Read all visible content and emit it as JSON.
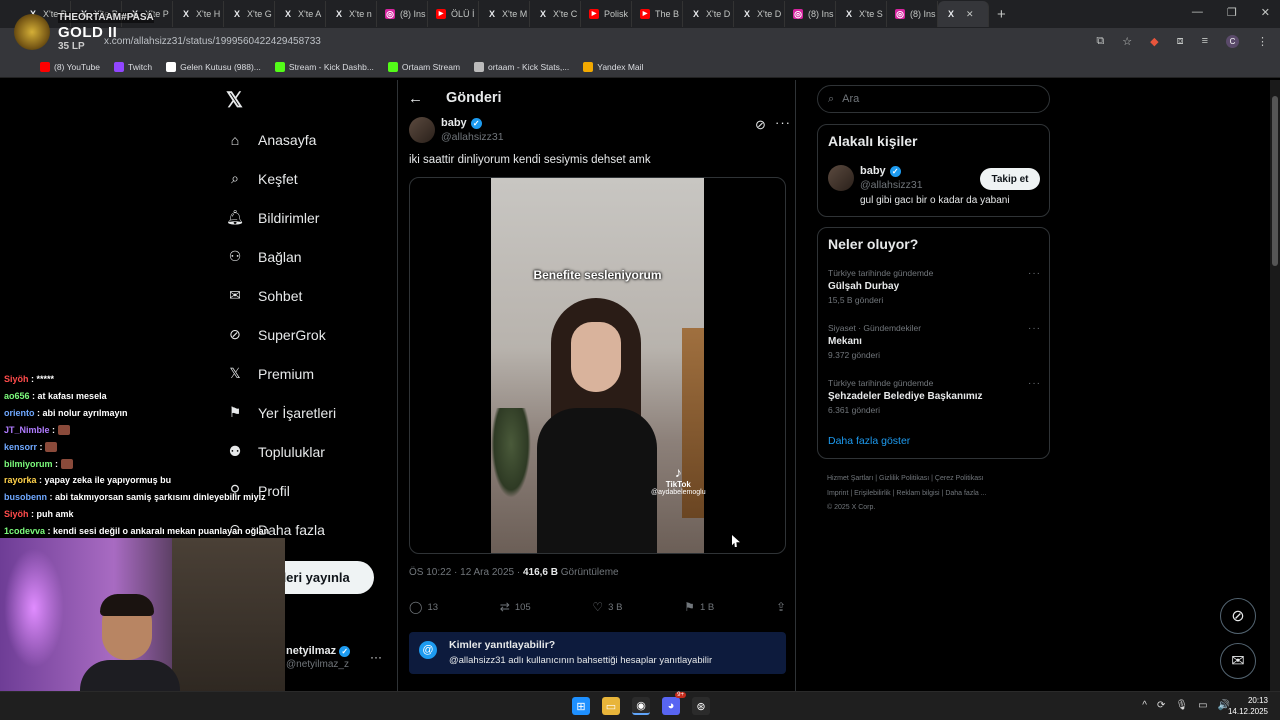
{
  "browser": {
    "tabs": [
      {
        "label": "X'te B",
        "icon": "x"
      },
      {
        "label": "X'te P",
        "icon": "x"
      },
      {
        "label": "X'te P",
        "icon": "x"
      },
      {
        "label": "X'te H",
        "icon": "x"
      },
      {
        "label": "X'te G",
        "icon": "x"
      },
      {
        "label": "X'te A",
        "icon": "x"
      },
      {
        "label": "X'te n",
        "icon": "x"
      },
      {
        "label": "(8) Ins",
        "icon": "instagram"
      },
      {
        "label": "ÖLÜ İ",
        "icon": "youtube"
      },
      {
        "label": "X'te M",
        "icon": "x"
      },
      {
        "label": "X'te C",
        "icon": "x"
      },
      {
        "label": "Polisk",
        "icon": "youtube"
      },
      {
        "label": "The B",
        "icon": "youtube"
      },
      {
        "label": "X'te D",
        "icon": "x"
      },
      {
        "label": "X'te D",
        "icon": "x"
      },
      {
        "label": "(8) Ins",
        "icon": "instagram"
      },
      {
        "label": "X'te S",
        "icon": "x"
      },
      {
        "label": "(8) Ins",
        "icon": "instagram"
      },
      {
        "label": "",
        "icon": "x",
        "active": true
      }
    ],
    "url": "x.com/allahsizz31/status/1999560422429458733",
    "bookmarks": [
      {
        "label": "(8) YouTube",
        "color": "#ff0000"
      },
      {
        "label": "Twitch",
        "color": "#9146ff"
      },
      {
        "label": "Gelen Kutusu (988)...",
        "color": "#ffffff"
      },
      {
        "label": "Stream - Kick Dashb...",
        "color": "#53fc18"
      },
      {
        "label": "Ortaam Stream",
        "color": "#53fc18"
      },
      {
        "label": "ortaam - Kick Stats,...",
        "color": "#bbbbbb"
      },
      {
        "label": "Yandex Mail",
        "color": "#f2a900"
      }
    ]
  },
  "overlay_rank": {
    "name": "THEORTAAM#PASA",
    "tier": "GOLD II",
    "lp": "35 LP"
  },
  "sidebar": {
    "items": [
      {
        "label": "Anasayfa",
        "icon": "home-icon"
      },
      {
        "label": "Keşfet",
        "icon": "search-icon"
      },
      {
        "label": "Bildirimler",
        "icon": "bell-icon"
      },
      {
        "label": "Bağlan",
        "icon": "add-person-icon"
      },
      {
        "label": "Sohbet",
        "icon": "mail-icon"
      },
      {
        "label": "SuperGrok",
        "icon": "grok-icon"
      },
      {
        "label": "Premium",
        "icon": "x-icon"
      },
      {
        "label": "Yer İşaretleri",
        "icon": "bookmark-icon"
      },
      {
        "label": "Topluluklar",
        "icon": "people-icon"
      },
      {
        "label": "Profil",
        "icon": "person-icon"
      },
      {
        "label": "Daha fazla",
        "icon": "more-circle-icon"
      }
    ],
    "post_button": "Gönderi yayınla",
    "user_name": "netyilmaz",
    "user_handle": "@netyilmaz_z"
  },
  "post": {
    "header_title": "Gönderi",
    "author_name": "baby",
    "author_handle": "@allahsizz31",
    "text": "iki saattir dinliyorum kendi sesiymis dehset amk",
    "video_caption": "Benefite sesleniyorum",
    "tiktok_label": "TikTok",
    "tiktok_user": "@aydabelemoglu",
    "timestamp": "ÖS 10:22 · 12 Ara 2025 · ",
    "views_count": "416,6 B",
    "views_label": " Görüntüleme",
    "replies": "13",
    "reposts": "105",
    "likes": "3 B",
    "bookmarks": "1 B",
    "reply_box_title": "Kimler yanıtlayabilir?",
    "reply_box_text": "@allahsizz31 adlı kullanıcının bahsettiği hesaplar yanıtlayabilir"
  },
  "right": {
    "search_placeholder": "Ara",
    "related_title": "Alakalı kişiler",
    "related_name": "baby",
    "related_handle": "@allahsizz31",
    "related_bio": "gul gibi gacı bir o kadar da yabani",
    "follow_label": "Takip et",
    "trends_title": "Neler oluyor?",
    "trends": [
      {
        "context": "Türkiye tarihinde gündemde",
        "name": "Gülşah Durbay",
        "posts": "15,5 B gönderi"
      },
      {
        "context": "Siyaset · Gündemdekiler",
        "name": "Mekanı",
        "posts": "9.372 gönderi"
      },
      {
        "context": "Türkiye tarihinde gündemde",
        "name": "Şehzadeler Belediye Başkanımız",
        "posts": "6.361 gönderi"
      }
    ],
    "show_more": "Daha fazla göster",
    "footer_links": [
      "Hizmet Şartları",
      "Gizlilik Politikası",
      "Çerez Politikası",
      "Imprint",
      "Erişilebilirlik",
      "Reklam bilgisi",
      "Daha fazla ..."
    ],
    "copyright": "© 2025 X Corp."
  },
  "chat": [
    {
      "user": "Siyöh",
      "color": "#ff4b4b",
      "msg": " : *****"
    },
    {
      "user": "ao656",
      "color": "#7cfc7c",
      "msg": " : at kafası mesela"
    },
    {
      "user": "oriento",
      "color": "#6fa8ff",
      "msg": " : abi nolur ayrılmayın"
    },
    {
      "user": "JT_Nimble",
      "color": "#b07cff",
      "msg": " : "
    },
    {
      "user": "kensorr",
      "color": "#6fa8ff",
      "msg": " : "
    },
    {
      "user": "bilmiyorum",
      "color": "#7cfc7c",
      "msg": " : "
    },
    {
      "user": "rayorka",
      "color": "#ffd24b",
      "msg": " : yapay zeka ile yapıyormuş bu"
    },
    {
      "user": "busobenn",
      "color": "#6fa8ff",
      "msg": " : abi takmıyorsan samiş şarkısını dinleyebilir miyiz"
    },
    {
      "user": "Siyöh",
      "color": "#ff4b4b",
      "msg": " : puh amk"
    },
    {
      "user": "1codevva",
      "color": "#7cfc7c",
      "msg": " : kendi sesi değil o ankaralı mekan puanlayan oğlan"
    }
  ],
  "taskbar": {
    "time": "20:13",
    "date": "14.12.2025",
    "discord_badge": "9+"
  }
}
